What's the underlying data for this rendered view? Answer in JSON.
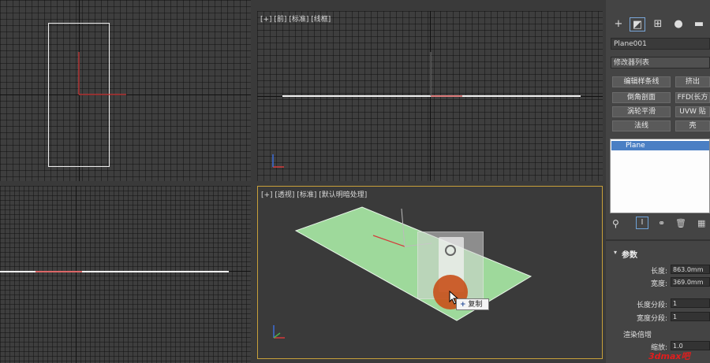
{
  "viewports": {
    "top_right_label": "[+] [前] [标准] [线框]",
    "bottom_right_label": "[+] [透视] [标准] [默认明暗处理]"
  },
  "tooltip": {
    "label": "复制",
    "icon": "plus-icon"
  },
  "command_panel": {
    "tabs": [
      "create-icon",
      "modify-icon",
      "hierarchy-icon",
      "motion-icon",
      "display-icon"
    ],
    "object_name": "Plane001",
    "modifier_list": "修改器列表",
    "buttons": [
      "编辑样条线",
      "挤出",
      "倒角剖面",
      "FFD(长方",
      "涡轮平滑",
      "UVW 贴",
      "法线",
      "壳"
    ],
    "stack_item": "Plane",
    "params_title": "参数",
    "length_label": "长度:",
    "length_value": "863.0mm",
    "width_label": "宽度:",
    "width_value": "369.0mm",
    "length_segs_label": "长度分段:",
    "length_segs_value": "1",
    "width_segs_label": "宽度分段:",
    "width_segs_value": "1",
    "render_mult_label": "渲染倍增",
    "scale_label": "缩放:",
    "scale_value": "1.0"
  },
  "watermark": "3dmax吧"
}
